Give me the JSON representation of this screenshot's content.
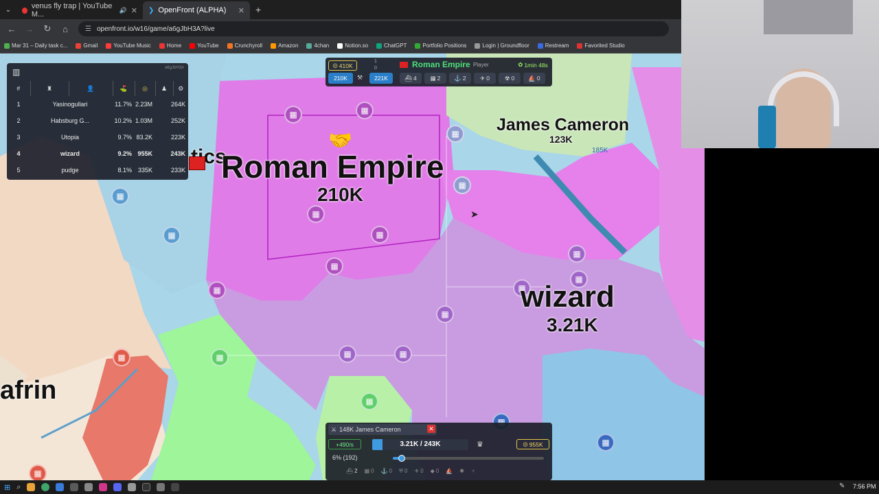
{
  "browser": {
    "tabs": [
      {
        "title": "venus fly trap | YouTube M...",
        "active": false
      },
      {
        "title": "OpenFront (ALPHA)",
        "active": true
      }
    ],
    "url": "openfront.io/w16/game/a6gJbH3A?live",
    "bookmarks": [
      "Mar 31 – Daily task c...",
      "Gmail",
      "YouTube Music",
      "Home",
      "YouTube",
      "Crunchyroll",
      "Amazon",
      "4chan",
      "Notion.so",
      "ChatGPT",
      "Portfolio Positions",
      "Login | Groundfloor",
      "Restream",
      "Favorited Studio"
    ]
  },
  "leaderboard": {
    "game_id": "a6gJbH3A",
    "rows": [
      {
        "rank": "1",
        "name": "Yasinogullari",
        "territory": "11.7%",
        "gold": "2.23M",
        "troops": "264K"
      },
      {
        "rank": "2",
        "name": "Habsburg G...",
        "territory": "10.2%",
        "gold": "1.03M",
        "troops": "252K"
      },
      {
        "rank": "3",
        "name": "Utopia",
        "territory": "9.7%",
        "gold": "83.2K",
        "troops": "223K"
      },
      {
        "rank": "4",
        "name": "wizard",
        "territory": "9.2%",
        "gold": "955K",
        "troops": "243K"
      },
      {
        "rank": "5",
        "name": "pudge",
        "territory": "8.1%",
        "gold": "335K",
        "troops": "233K"
      }
    ]
  },
  "player_bar": {
    "gold": "410K",
    "small_count": "1",
    "small_zero": "0",
    "name": "Roman Empire",
    "role": "Player",
    "timer": "1min 48s",
    "troops": "210K",
    "workers": "221K",
    "units": [
      "4",
      "2",
      "2",
      "0",
      "0",
      "0"
    ]
  },
  "map_labels": {
    "roman_name": "Roman Empire",
    "roman_troops": "210K",
    "james_name": "James Cameron",
    "james_troops": "123K",
    "wizard_name": "wizard",
    "wizard_troops": "3.21K",
    "afrin_name": "afrin",
    "partial_tics": "tics",
    "small_185": "185K"
  },
  "bottom_control": {
    "attack_label": "148K James Cameron",
    "troop_rate": "+490/s",
    "troops_display": "3.21K / 243K",
    "gold": "955K",
    "attack_ratio": "6% (192)",
    "build_counts": [
      "2",
      "0",
      "0",
      "0",
      "0",
      "0"
    ]
  },
  "taskbar": {
    "time": "7:56 PM"
  },
  "colors": {
    "roman": "#e07ce8",
    "wizard": "#c99be0",
    "james": "#c9e6b8",
    "green": "#9ef59a",
    "blue": "#8fc6e8",
    "red": "#e8786a",
    "panel": "#1c202a"
  }
}
